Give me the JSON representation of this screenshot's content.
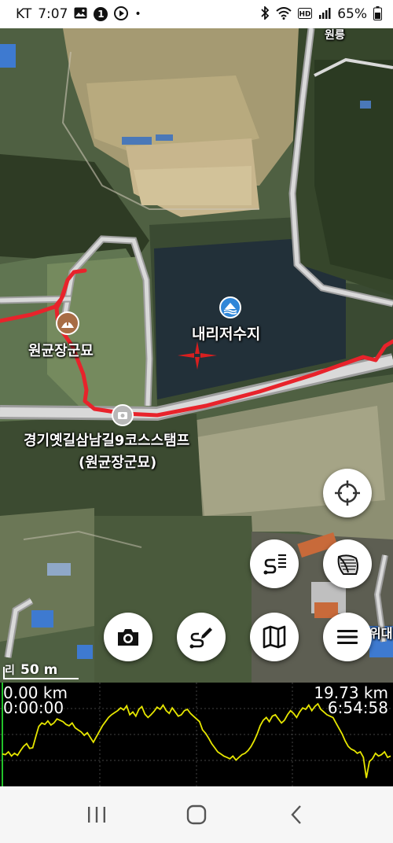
{
  "status_bar": {
    "carrier": "KT",
    "time": "7:07",
    "notification_count": "1",
    "battery": "65%",
    "icons": [
      "gallery-icon",
      "play-icon",
      "bluetooth-icon",
      "wifi-icon",
      "hd-icon",
      "signal-icon",
      "battery-icon"
    ]
  },
  "map": {
    "labels": {
      "reservoir": "내리저수지",
      "tomb": "원균장군묘",
      "stamp_line1": "경기옛길삼남길9코스스탬프",
      "stamp_line2": "(원균장군묘)",
      "road_top": "원릉",
      "right_edge": "위대"
    },
    "scale_label": "50 m",
    "scale_side_text": "리",
    "track_color": "#e8232b",
    "road_color": "#d9d9d9"
  },
  "buttons": {
    "gps": "crosshair-icon",
    "track_list": "route-list-icon",
    "layers": "layers-icon",
    "camera": "camera-icon",
    "draw_route": "draw-route-icon",
    "map": "map-icon",
    "menu": "hamburger-menu-icon"
  },
  "elevation": {
    "start_distance": "0.00 km",
    "start_time": "0:00:00",
    "end_distance": "19.73 km",
    "end_time": "6:54:58",
    "line_color": "#e6e600",
    "grid_color": "#444444",
    "profile": [
      0.15,
      0.14,
      0.18,
      0.12,
      0.16,
      0.13,
      0.2,
      0.26,
      0.3,
      0.23,
      0.24,
      0.4,
      0.55,
      0.6,
      0.58,
      0.63,
      0.57,
      0.6,
      0.66,
      0.64,
      0.62,
      0.58,
      0.56,
      0.6,
      0.53,
      0.5,
      0.47,
      0.42,
      0.46,
      0.39,
      0.32,
      0.4,
      0.48,
      0.56,
      0.62,
      0.68,
      0.72,
      0.75,
      0.78,
      0.82,
      0.79,
      0.85,
      0.72,
      0.76,
      0.7,
      0.8,
      0.84,
      0.73,
      0.68,
      0.72,
      0.77,
      0.83,
      0.8,
      0.86,
      0.78,
      0.74,
      0.82,
      0.76,
      0.7,
      0.72,
      0.78,
      0.8,
      0.74,
      0.7,
      0.66,
      0.62,
      0.5,
      0.45,
      0.38,
      0.3,
      0.24,
      0.18,
      0.15,
      0.12,
      0.1,
      0.08,
      0.12,
      0.06,
      0.1,
      0.14,
      0.16,
      0.2,
      0.26,
      0.34,
      0.44,
      0.56,
      0.64,
      0.68,
      0.62,
      0.7,
      0.72,
      0.66,
      0.6,
      0.64,
      0.72,
      0.78,
      0.74,
      0.68,
      0.76,
      0.82,
      0.8,
      0.86,
      0.78,
      0.84,
      0.88,
      0.8,
      0.76,
      0.72,
      0.7,
      0.68,
      0.6,
      0.52,
      0.44,
      0.34,
      0.26,
      0.22,
      0.2,
      0.16,
      0.18,
      0.1,
      -0.2,
      0.04,
      0.08,
      0.16,
      0.12,
      0.14,
      0.18,
      0.1,
      0.12
    ]
  },
  "nav_bar": {
    "recents": "recents-icon",
    "home": "home-icon",
    "back": "back-icon"
  }
}
